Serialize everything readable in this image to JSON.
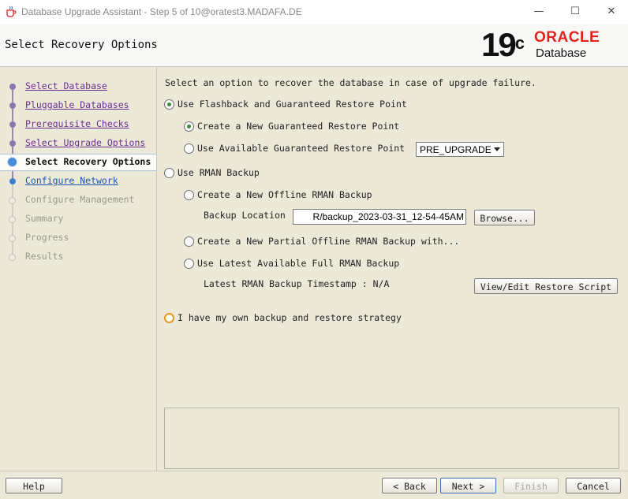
{
  "window": {
    "title": "Database Upgrade Assistant - Step 5 of 10@oratest3.MADAFA.DE",
    "minimize": "—",
    "maximize": "☐",
    "close": "✕"
  },
  "header": {
    "page_title": "Select Recovery Options",
    "version": "19",
    "version_suffix": "c",
    "brand": "ORACLE",
    "product": "Database"
  },
  "nav": {
    "steps": [
      {
        "label": "Select Database",
        "state": "done"
      },
      {
        "label": "Pluggable Databases",
        "state": "done"
      },
      {
        "label": "Prerequisite Checks",
        "state": "done"
      },
      {
        "label": "Select Upgrade Options",
        "state": "done"
      },
      {
        "label": "Select Recovery Options",
        "state": "current"
      },
      {
        "label": "Configure Network",
        "state": "next"
      },
      {
        "label": "Configure Management",
        "state": "pending"
      },
      {
        "label": "Summary",
        "state": "pending"
      },
      {
        "label": "Progress",
        "state": "pending"
      },
      {
        "label": "Results",
        "state": "pending"
      }
    ]
  },
  "content": {
    "instruction": "Select an option to recover the database in case of upgrade failure.",
    "flashback": {
      "label": "Use Flashback and Guaranteed Restore Point",
      "create_new": "Create a New Guaranteed Restore Point",
      "use_available": "Use Available Guaranteed Restore Point",
      "restore_point_selected": "PRE_UPGRADE"
    },
    "rman": {
      "label": "Use RMAN Backup",
      "create_offline": "Create a New Offline RMAN Backup",
      "backup_location_label": "Backup Location",
      "backup_location_value": "R/backup_2023-03-31_12-54-45AM",
      "browse": "Browse...",
      "create_partial": "Create a New Partial Offline RMAN Backup with...",
      "use_latest": "Use Latest Available Full RMAN Backup",
      "latest_timestamp": "Latest RMAN Backup Timestamp : N/A",
      "view_edit": "View/Edit Restore Script"
    },
    "own_strategy": "I have my own backup and restore strategy"
  },
  "footer": {
    "help": "Help",
    "back": "< Back",
    "next": "Next >",
    "finish": "Finish",
    "cancel": "Cancel"
  },
  "colors": {
    "accent": "#e2231a",
    "visited_link": "#6a2d8f",
    "link": "#1b55b0",
    "selected_radio": "#3d8a3d",
    "focus_ring": "#e39a1e"
  }
}
